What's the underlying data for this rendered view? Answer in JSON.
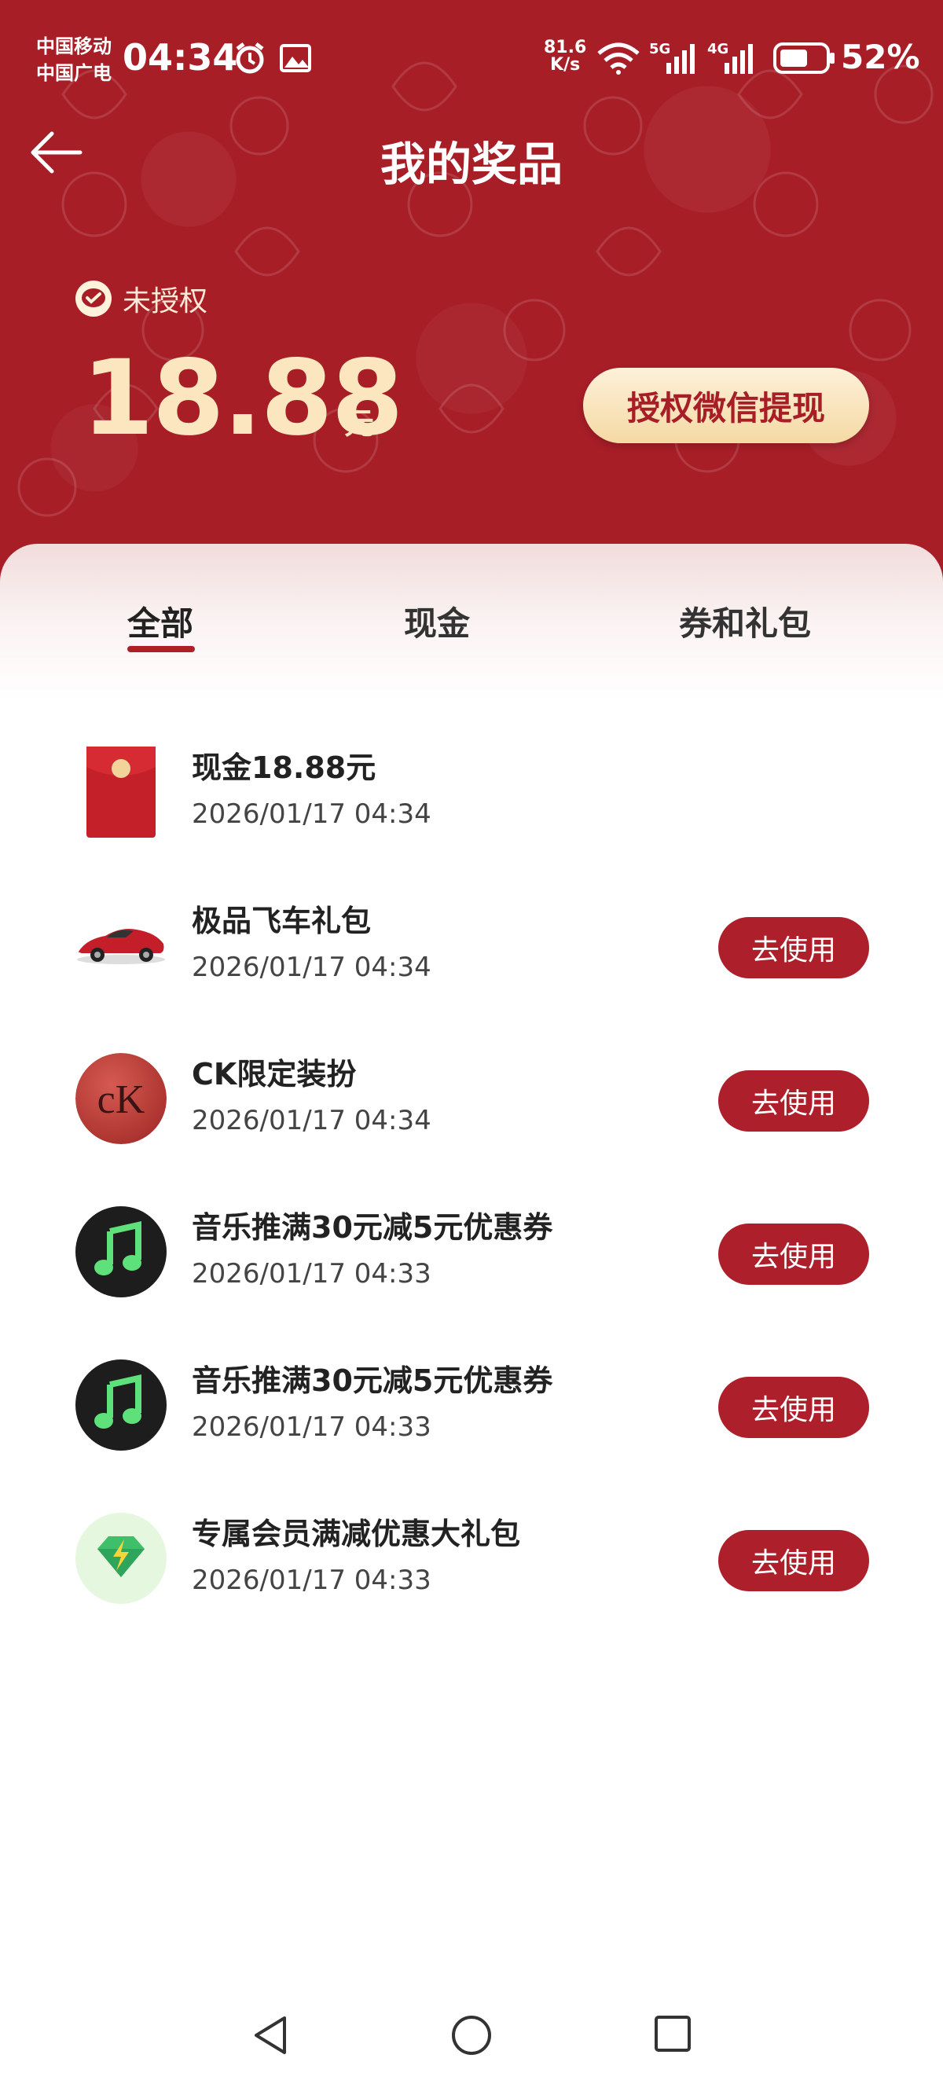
{
  "status_bar": {
    "carrier_1": "中国移动",
    "carrier_2": "中国广电",
    "time": "04:34",
    "speed_value": "81.6",
    "speed_unit": "K/s",
    "network_1": "5G",
    "network_2": "4G",
    "battery_percent": "52%"
  },
  "header": {
    "title": "我的奖品"
  },
  "balance": {
    "auth_status": "未授权",
    "amount": "18.88",
    "unit": "元",
    "withdraw_label": "授权微信提现"
  },
  "tabs": [
    {
      "label": "全部",
      "active": true
    },
    {
      "label": "现金",
      "active": false
    },
    {
      "label": "券和礼包",
      "active": false
    }
  ],
  "prizes": [
    {
      "title": "现金18.88元",
      "date": "2026/01/17 04:34",
      "icon": "red-envelope-icon",
      "action": ""
    },
    {
      "title": "极品飞车礼包",
      "date": "2026/01/17 04:34",
      "icon": "sports-car-icon",
      "action": "去使用"
    },
    {
      "title": "CK限定装扮",
      "date": "2026/01/17 04:34",
      "icon": "ck-logo-icon",
      "action": "去使用"
    },
    {
      "title": "音乐推满30元减5元优惠券",
      "date": "2026/01/17 04:33",
      "icon": "music-note-icon",
      "action": "去使用"
    },
    {
      "title": "音乐推满30元减5元优惠券",
      "date": "2026/01/17 04:33",
      "icon": "music-note-icon",
      "action": "去使用"
    },
    {
      "title": "专属会员满减优惠大礼包",
      "date": "2026/01/17 04:33",
      "icon": "diamond-lightning-icon",
      "action": "去使用"
    }
  ],
  "colors": {
    "brand_red": "#a81e27",
    "button_red": "#ad1f2a",
    "gold_text": "#fbe6bf"
  }
}
